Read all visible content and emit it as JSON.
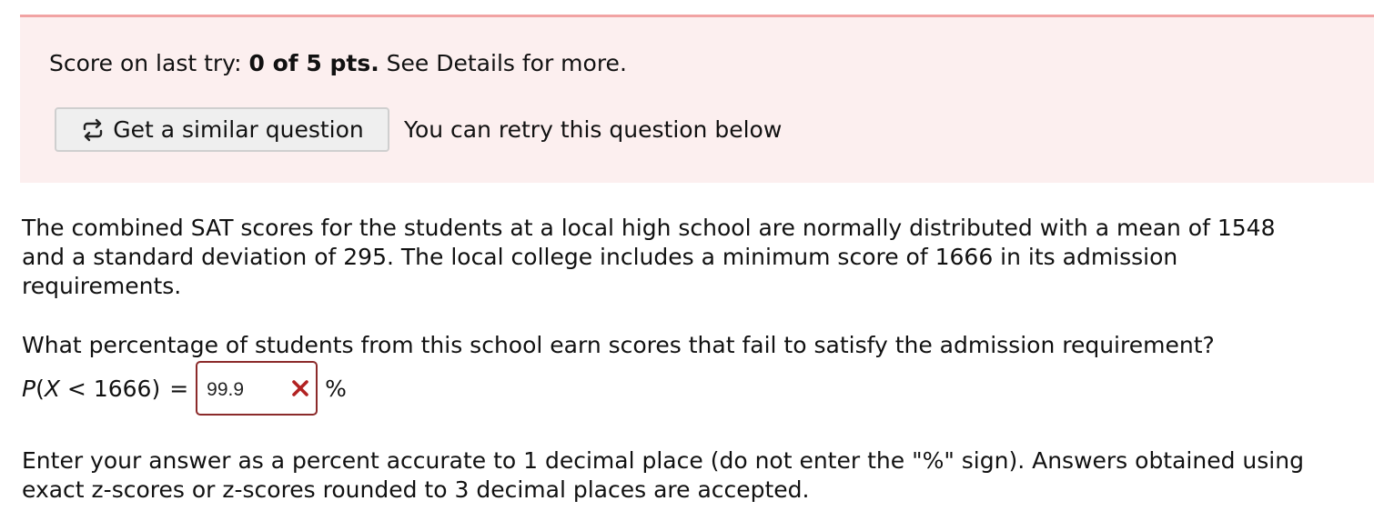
{
  "score": {
    "prefix": "Score on last try: ",
    "value": "0 of 5 pts.",
    "suffix": " See Details for more."
  },
  "similar_button": {
    "label": "Get a similar question",
    "icon": "retry-icon"
  },
  "retry_message": "You can retry this question below",
  "question": {
    "text": "The combined SAT scores for the students at a local high school are normally distributed with a mean of 1548 and a standard deviation of 295. The local college includes a minimum score of 1666 in its admission requirements.",
    "prompt": "What percentage of students from this school earn scores that fail to satisfy the admission requirement?"
  },
  "answer": {
    "expression_p": "P",
    "expression_open": "(",
    "expression_x": "X",
    "expression_rest": " < 1666)",
    "equals": "=",
    "value": "99.9",
    "status_icon": "wrong-x-icon",
    "unit": "%"
  },
  "hint": "Enter your answer as a percent accurate to 1 decimal place (do not enter the \"%\" sign). Answers obtained using exact z-scores or z-scores rounded to 3 decimal places are accepted.",
  "colors": {
    "panel_background": "#fcefef",
    "panel_border": "#f1a3a3",
    "error": "#b22222",
    "answer_border": "#8b2a2a"
  }
}
